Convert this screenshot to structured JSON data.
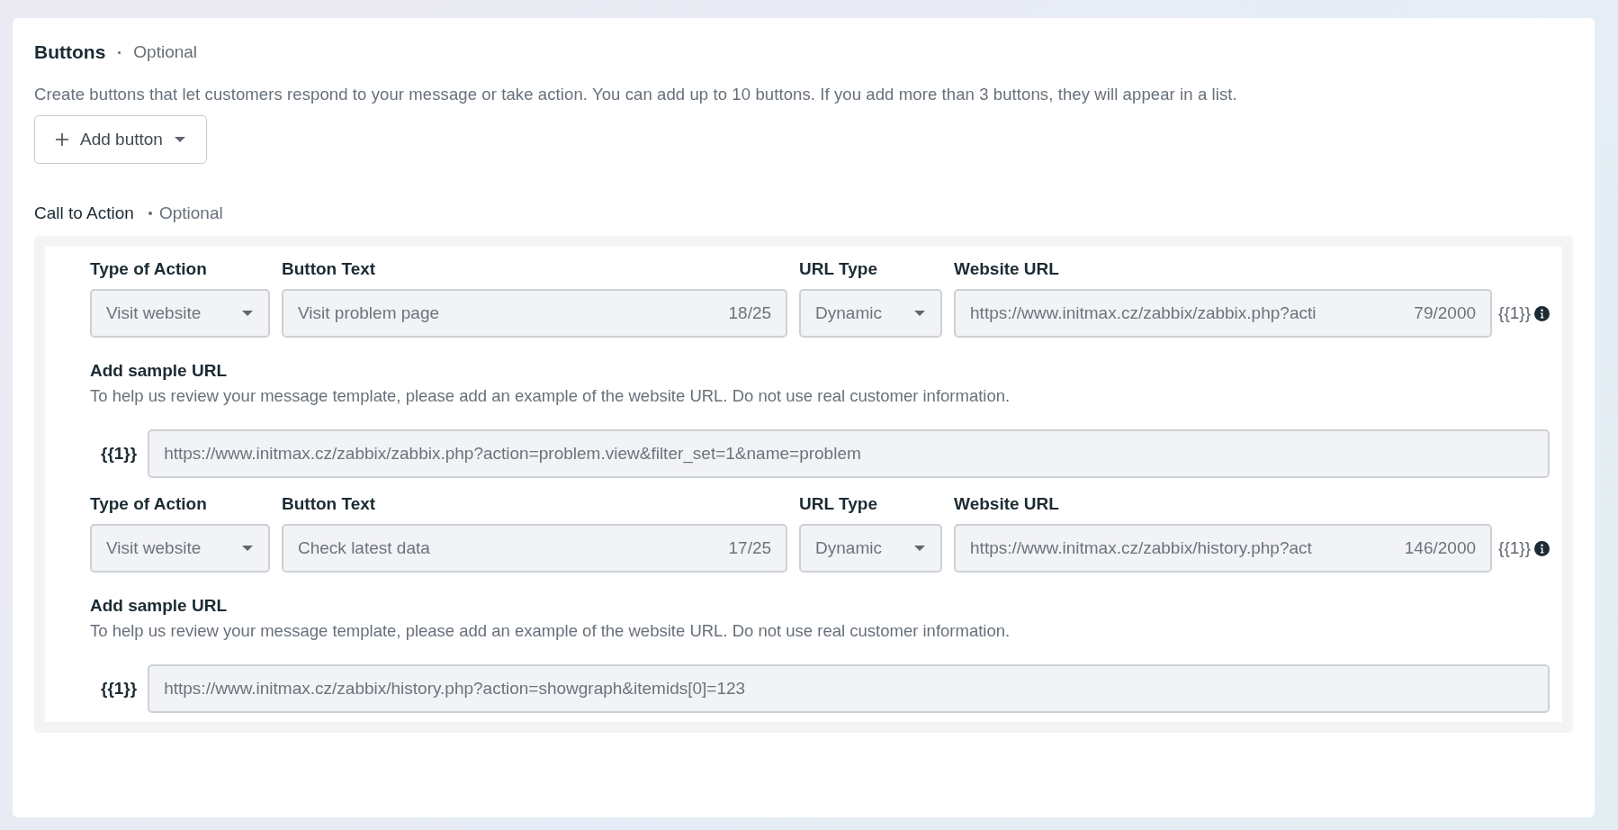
{
  "section": {
    "title": "Buttons",
    "optional": "Optional",
    "description": "Create buttons that let customers respond to your message or take action. You can add up to 10 buttons. If you add more than 3 buttons, they will appear in a list.",
    "add_button": {
      "label": "Add button"
    }
  },
  "call_to_action": {
    "title": "Call to Action",
    "optional": "Optional",
    "items": [
      {
        "type_label": "Type of Action",
        "type_value": "Visit website",
        "text_label": "Button Text",
        "text_value": "Visit problem page",
        "text_count": "18/25",
        "url_type_label": "URL Type",
        "url_type_value": "Dynamic",
        "url_label": "Website URL",
        "url_value": "https://www.initmax.cz/zabbix/zabbix.php?acti",
        "url_count": "79/2000",
        "variable": "{{1}}",
        "sample_title": "Add sample URL",
        "sample_hint": "To help us review your message template, please add an example of the website URL. Do not use real customer information.",
        "sample_variable": "{{1}}",
        "sample_value": "https://www.initmax.cz/zabbix/zabbix.php?action=problem.view&filter_set=1&name=problem"
      },
      {
        "type_label": "Type of Action",
        "type_value": "Visit website",
        "text_label": "Button Text",
        "text_value": "Check latest data",
        "text_count": "17/25",
        "url_type_label": "URL Type",
        "url_type_value": "Dynamic",
        "url_label": "Website URL",
        "url_value": "https://www.initmax.cz/zabbix/history.php?act",
        "url_count": "146/2000",
        "variable": "{{1}}",
        "sample_title": "Add sample URL",
        "sample_hint": "To help us review your message template, please add an example of the website URL. Do not use real customer information.",
        "sample_variable": "{{1}}",
        "sample_value": "https://www.initmax.cz/zabbix/history.php?action=showgraph&itemids[0]=123"
      }
    ]
  }
}
